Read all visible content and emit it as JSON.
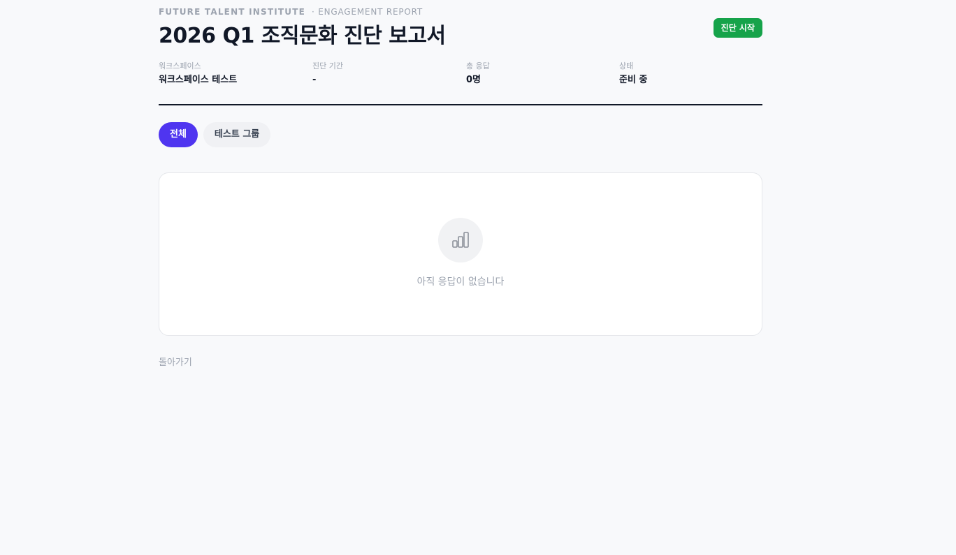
{
  "header": {
    "org": "FUTURE TALENT INSTITUTE",
    "subtitle": "· ENGAGEMENT REPORT",
    "title": "2026 Q1 조직문화 진단 보고서",
    "start_button": "진단 시작"
  },
  "meta": [
    {
      "label": "워크스페이스",
      "value": "워크스페이스 테스트"
    },
    {
      "label": "진단 기간",
      "value": "-"
    },
    {
      "label": "총 응답",
      "value": "0명"
    },
    {
      "label": "상태",
      "value": "준비 중"
    }
  ],
  "tabs": [
    {
      "label": "전체",
      "active": true
    },
    {
      "label": "테스트 그룹",
      "active": false
    }
  ],
  "empty_state": {
    "icon": "bar-chart-icon",
    "message": "아직 응답이 없습니다"
  },
  "back_link": "돌아가기",
  "colors": {
    "accent": "#4f35f0",
    "start_button": "#16a34a",
    "background": "#f8f9fb"
  }
}
